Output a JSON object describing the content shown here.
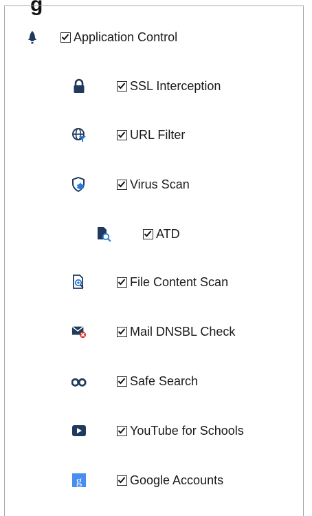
{
  "header": {
    "partial_title": "g"
  },
  "features": [
    {
      "label": "Application Control",
      "checked": true,
      "icon": "rocket-icon"
    },
    {
      "label": "SSL Interception",
      "checked": true,
      "icon": "lock-icon"
    },
    {
      "label": "URL Filter",
      "checked": true,
      "icon": "globe-filter-icon"
    },
    {
      "label": "Virus Scan",
      "checked": true,
      "icon": "shield-bug-icon"
    },
    {
      "label": "ATD",
      "checked": true,
      "icon": "file-magnifier-icon"
    },
    {
      "label": "File Content Scan",
      "checked": true,
      "icon": "file-zoom-icon"
    },
    {
      "label": "Mail DNSBL Check",
      "checked": true,
      "icon": "mail-blocked-icon"
    },
    {
      "label": "Safe Search",
      "checked": true,
      "icon": "binoculars-icon"
    },
    {
      "label": "YouTube for Schools",
      "checked": true,
      "icon": "youtube-play-icon"
    },
    {
      "label": "Google Accounts",
      "checked": true,
      "icon": "google-icon"
    }
  ],
  "colors": {
    "icon_dark": "#1f3a5c",
    "icon_blue": "#2a7ad8",
    "icon_red": "#d9302b",
    "google_blue": "#4a8df0"
  }
}
